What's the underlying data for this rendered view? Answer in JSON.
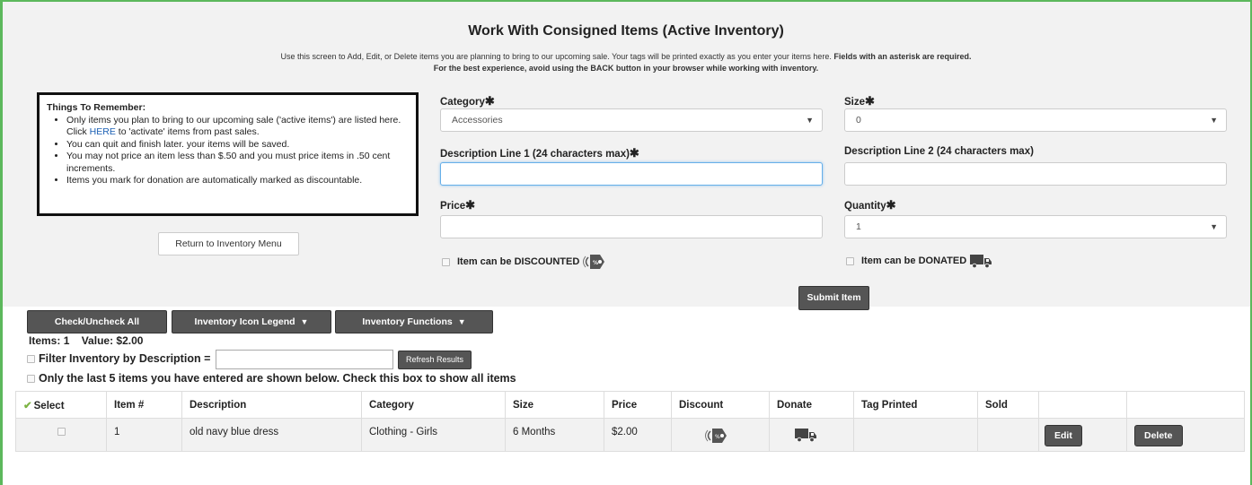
{
  "page": {
    "title": "Work With Consigned Items (Active Inventory)",
    "intro_plain": "Use this screen to Add, Edit, or Delete items you are planning to bring to our upcoming sale. Your tags will be printed exactly as you enter your items here.",
    "intro_bold": "Fields with an asterisk are required.",
    "intro2": "For the best experience, avoid using the BACK button in your browser while working with inventory."
  },
  "remember": {
    "heading": "Things To Remember:",
    "item1_a": "Only items you plan to bring to our upcoming sale ('active items') are listed here. Click ",
    "item1_link": "HERE",
    "item1_b": " to 'activate' items from past sales.",
    "item2": "You can quit and finish later. your items will be saved.",
    "item3": "You may not price an item less than $.50 and you must price items in .50 cent increments.",
    "item4": "Items you mark for donation are automatically marked as discountable."
  },
  "buttons": {
    "return": "Return to Inventory Menu",
    "submit": "Submit Item",
    "check_all": "Check/Uncheck All",
    "icon_legend": "Inventory Icon Legend",
    "functions": "Inventory Functions",
    "refresh": "Refresh Results"
  },
  "form": {
    "category_label": "Category",
    "category_value": "Accessories",
    "size_label": "Size",
    "size_value": "0",
    "desc1_label": "Description Line 1 (24 characters max)",
    "desc1_value": "",
    "desc2_label": "Description Line 2 (24 characters max)",
    "desc2_value": "",
    "price_label": "Price",
    "price_value": "",
    "quantity_label": "Quantity",
    "quantity_value": "1",
    "discount_label": "Item can be DISCOUNTED",
    "donate_label": "Item can be DONATED",
    "asterisk": "✱"
  },
  "summary": {
    "items_label": "Items:",
    "items_count": "1",
    "value_label": "Value:",
    "value_amount": "$2.00",
    "filter_label": "Filter Inventory by Description =",
    "only_last_label": "Only the last 5 items you have entered are shown below. Check this box to show all items"
  },
  "table": {
    "headers": [
      "Select",
      "Item #",
      "Description",
      "Category",
      "Size",
      "Price",
      "Discount",
      "Donate",
      "Tag Printed",
      "Sold",
      "",
      ""
    ],
    "rows": [
      {
        "item_no": "1",
        "description": "old navy blue dress",
        "category": "Clothing - Girls",
        "size": "6 Months",
        "price": "$2.00",
        "tag_printed": "",
        "sold": "",
        "edit": "Edit",
        "delete": "Delete"
      }
    ]
  },
  "colors": {
    "accent_green": "#5cb85c",
    "dark_button": "#555555",
    "link_blue": "#1a5fb4"
  }
}
